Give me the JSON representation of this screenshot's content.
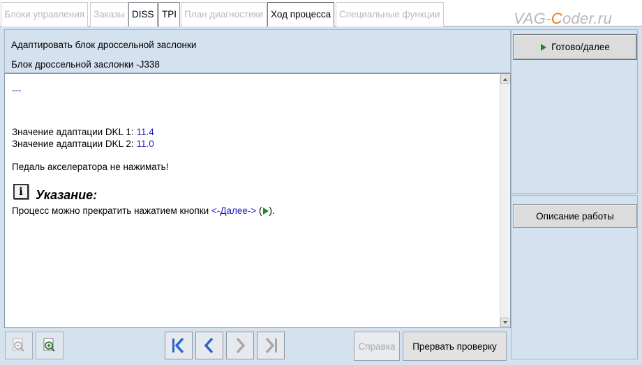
{
  "tabs": [
    {
      "label": "Блоки управления",
      "state": "disabled"
    },
    {
      "label": "Заказы",
      "state": "disabled"
    },
    {
      "label": "DISS",
      "state": "enabled"
    },
    {
      "label": "TPI",
      "state": "enabled"
    },
    {
      "label": "План диагностики",
      "state": "disabled"
    },
    {
      "label": "Ход процесса",
      "state": "active"
    },
    {
      "label": "Специальные функции",
      "state": "disabled"
    }
  ],
  "watermark": {
    "prefix": "VAG-",
    "accent": "C",
    "suffix": "oder.ru"
  },
  "header": {
    "line1": "Адаптировать блок дроссельной заслонки",
    "line2": "Блок дроссельной заслонки -J338"
  },
  "content": {
    "dashes": "---",
    "adaptation": [
      {
        "label": "Значение адаптации DKL 1: ",
        "value": "11.4"
      },
      {
        "label": "Значение адаптации DKL 2: ",
        "value": "11.0"
      }
    ],
    "warning": "Педаль акселератора не нажимать!",
    "note_title": "Указание:",
    "note_text": "Процесс можно прекратить нажатием кнопки ",
    "note_link": "<-Далее->",
    "note_open": " (",
    "note_close": ")."
  },
  "toolbar": {
    "help_label": "Справка",
    "abort_label": "Прервать проверку"
  },
  "right_panel": {
    "next_label": "Готово/далее",
    "description_label": "Описание работы"
  },
  "icons": {
    "info": "info-icon",
    "zoom_out": "zoom-out-icon",
    "zoom_in": "zoom-in-icon",
    "first": "first-page-icon",
    "prev": "prev-icon",
    "next": "next-icon",
    "last": "last-page-icon"
  },
  "colors": {
    "accent_blue": "#1c1cc8",
    "play_green": "#1f8a1f",
    "panel_bg": "#d4e1ef",
    "nav_active": "#2a66c9",
    "watermark_accent": "#e87a1c"
  }
}
